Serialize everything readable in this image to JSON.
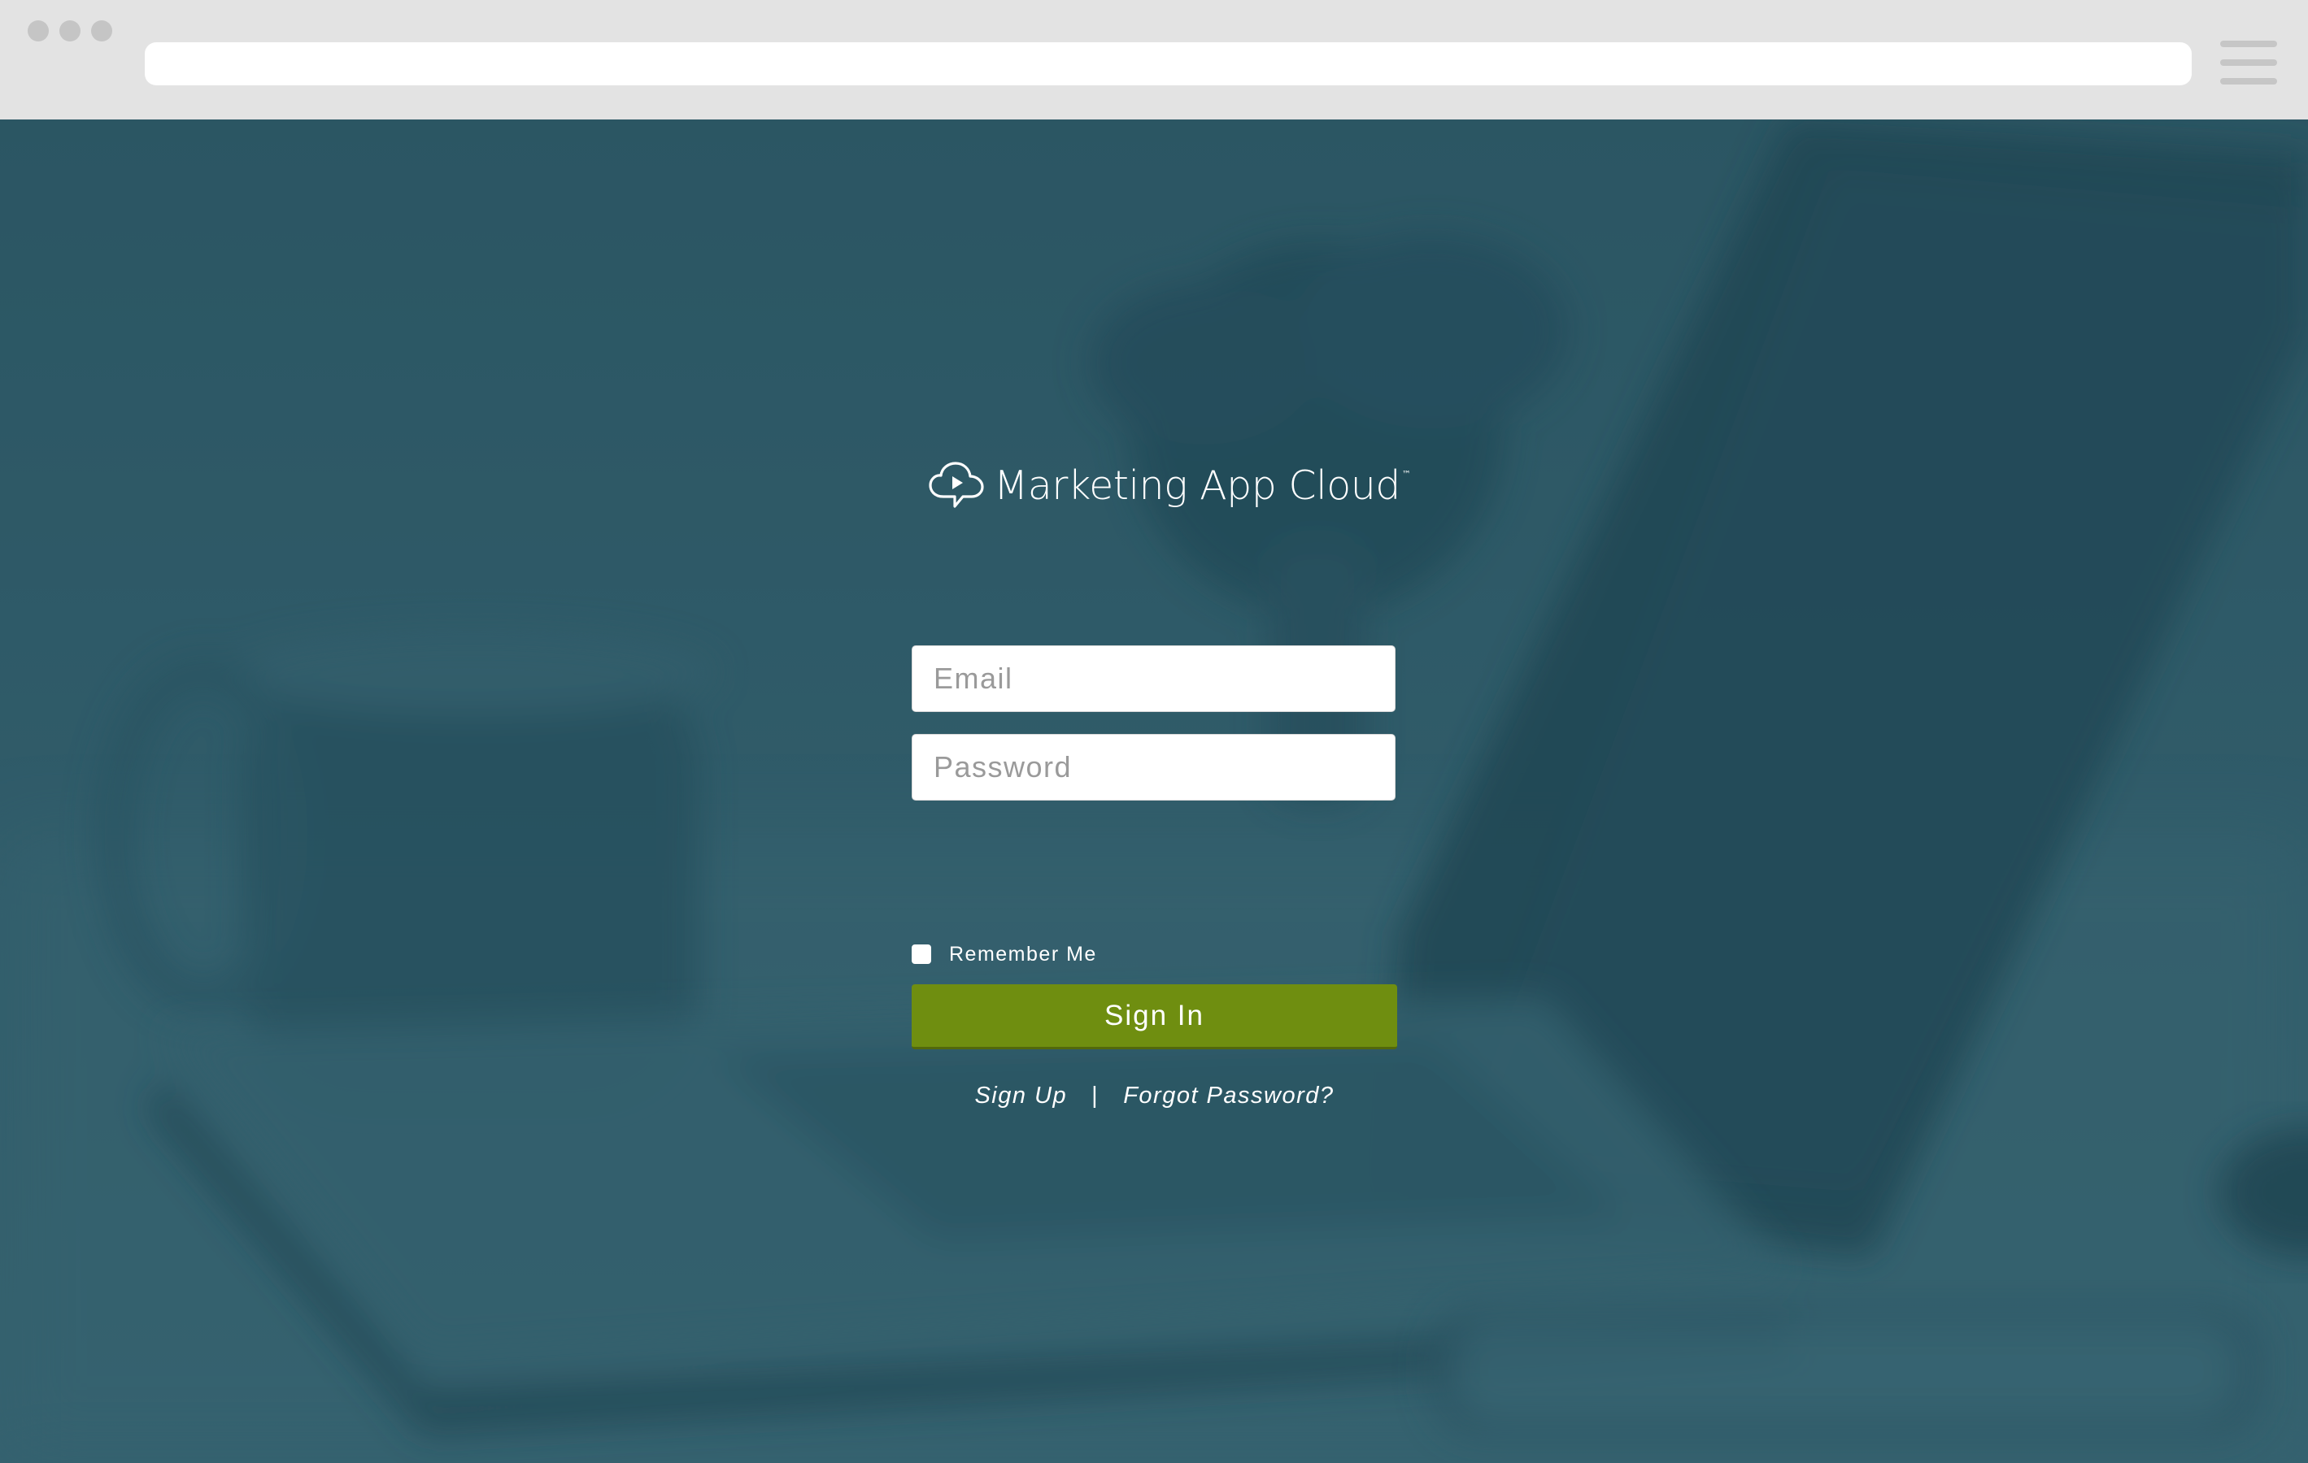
{
  "browser": {
    "url": ""
  },
  "colors": {
    "chrome": "#e3e3e3",
    "hero_overlay": "#2f5966",
    "accent_button": "#6f8e10",
    "field_background": "#ffffff"
  },
  "brand": {
    "name": "Marketing App Cloud",
    "trademark": "™",
    "icon": "cloud-play-icon"
  },
  "form": {
    "email_placeholder": "Email",
    "password_placeholder": "Password",
    "remember_label": "Remember Me",
    "remember_checked": false,
    "submit_label": "Sign In"
  },
  "links": {
    "signup": "Sign Up",
    "separator": "|",
    "forgot": "Forgot Password?"
  }
}
